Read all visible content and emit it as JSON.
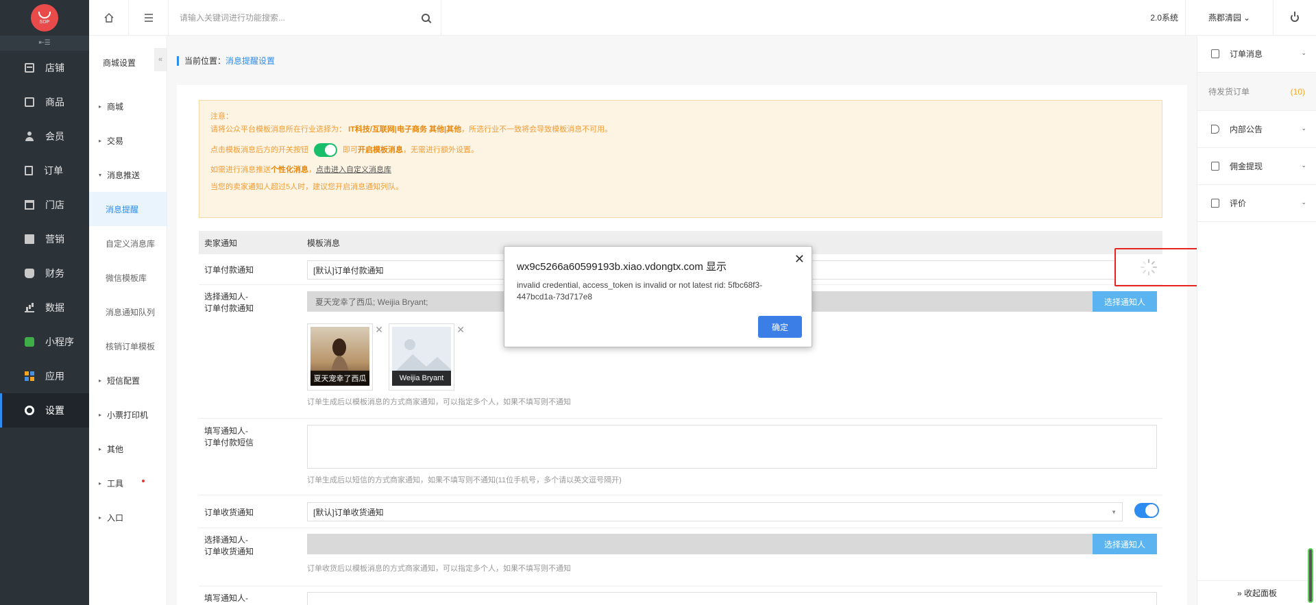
{
  "app": {
    "logo_text": "SDP",
    "version": "2.0系统",
    "user": "燕郡清园",
    "user_caret": "⌄"
  },
  "search": {
    "placeholder": "请输入关键词进行功能搜索..."
  },
  "nav": {
    "collapse_label": "⇤☰",
    "items": [
      {
        "label": "店铺",
        "icon": "store-icon"
      },
      {
        "label": "商品",
        "icon": "goods-icon"
      },
      {
        "label": "会员",
        "icon": "user-icon"
      },
      {
        "label": "订单",
        "icon": "order-icon"
      },
      {
        "label": "门店",
        "icon": "shop-icon"
      },
      {
        "label": "营销",
        "icon": "gift-icon"
      },
      {
        "label": "财务",
        "icon": "money-bag-icon"
      },
      {
        "label": "数据",
        "icon": "chart-icon"
      },
      {
        "label": "小程序",
        "icon": "miniprogram-icon"
      },
      {
        "label": "应用",
        "icon": "apps-icon"
      },
      {
        "label": "设置",
        "icon": "gear-icon",
        "active": true
      }
    ]
  },
  "submenu": {
    "title": "商城设置",
    "fold": "«",
    "items": [
      {
        "label": "商城",
        "arrow": "▸"
      },
      {
        "label": "交易",
        "arrow": "▸"
      },
      {
        "label": "消息推送",
        "arrow": "▾"
      },
      {
        "label": "消息提醒",
        "child": true,
        "active": true
      },
      {
        "label": "自定义消息库",
        "child": true
      },
      {
        "label": "微信模板库",
        "child": true
      },
      {
        "label": "消息通知队列",
        "child": true
      },
      {
        "label": "核销订单模板",
        "child": true
      },
      {
        "label": "短信配置",
        "arrow": "▸"
      },
      {
        "label": "小票打印机",
        "arrow": "▸"
      },
      {
        "label": "其他",
        "arrow": "▸"
      },
      {
        "label": "工具",
        "arrow": "▸"
      },
      {
        "label": "入口",
        "arrow": "▸"
      }
    ]
  },
  "breadcrumb": {
    "prefix": "当前位置：",
    "current": "消息提醒设置"
  },
  "notice": {
    "line1": "注意：",
    "line2_prefix": "请将公众平台模板消息所在行业选择为：",
    "line2_bold": "IT科技/互联网|电子商务 其他|其他",
    "line2_suffix": "，所选行业不一致将会导致模板消息不可用。",
    "line3_prefix": "点击模板消息后方的开关按钮",
    "line3_mid": "即可",
    "line3_bold": "开启模板消息",
    "line3_suffix": "，无需进行额外设置。",
    "line4_prefix": "如需进行消息推送",
    "line4_bold": "个性化消息",
    "line4_sep": "，",
    "line4_link": "点击进入自定义消息库",
    "line5": "当您的卖家通知人超过5人时，建议您开启消息通知列队。"
  },
  "table": {
    "col1": "卖家通知",
    "col2": "模板消息"
  },
  "sections": {
    "pay_notice_label": "订单付款通知",
    "pay_notice_value": "[默认]订单付款通知",
    "pay_select_label": "选择通知人-\n订单付款通知",
    "pay_selected_names": "夏天宠幸了西瓜; Weijia Bryant;",
    "select_btn": "选择通知人",
    "avatar1_name": "夏天宠幸了西瓜",
    "avatar2_name": "Weijia Bryant",
    "remove_icon": "✕",
    "pay_hint": "订单生成后以模板消息的方式商家通知，可以指定多个人，如果不填写则不通知",
    "pay_sms_label": "填写通知人-\n订单付款短信",
    "pay_sms_hint": "订单生成后以短信的方式商家通知，如果不填写则不通知(11位手机号，多个请以英文逗号隔开)",
    "recv_notice_label": "订单收货通知",
    "recv_notice_value": "[默认]订单收货通知",
    "recv_select_label": "选择通知人-\n订单收货通知",
    "recv_hint": "订单收货后以模板消息的方式商家通知，可以指定多个人，如果不填写则不通知",
    "recv_sms_label": "填写通知人-"
  },
  "right_panel": {
    "order_msg": "订单消息",
    "pending": "待发货订单",
    "pending_count": "(10)",
    "announcement": "内部公告",
    "commission": "佣金提现",
    "review": "评价",
    "collapse": "» 收起面板"
  },
  "dialog": {
    "title": "wx9c5266a60599193b.xiao.vdongtx.com 显示",
    "message": "invalid credential, access_token is invalid or not latest rid: 5fbc68f3-447bcd1a-73d717e8",
    "ok": "确定",
    "close": "✕"
  },
  "colors": {
    "accent": "#2d8cf0",
    "sidebar": "#2b3238",
    "notice_text": "#f29d38",
    "toggle_green": "#19be6b",
    "highlight_red": "#e8231f"
  }
}
